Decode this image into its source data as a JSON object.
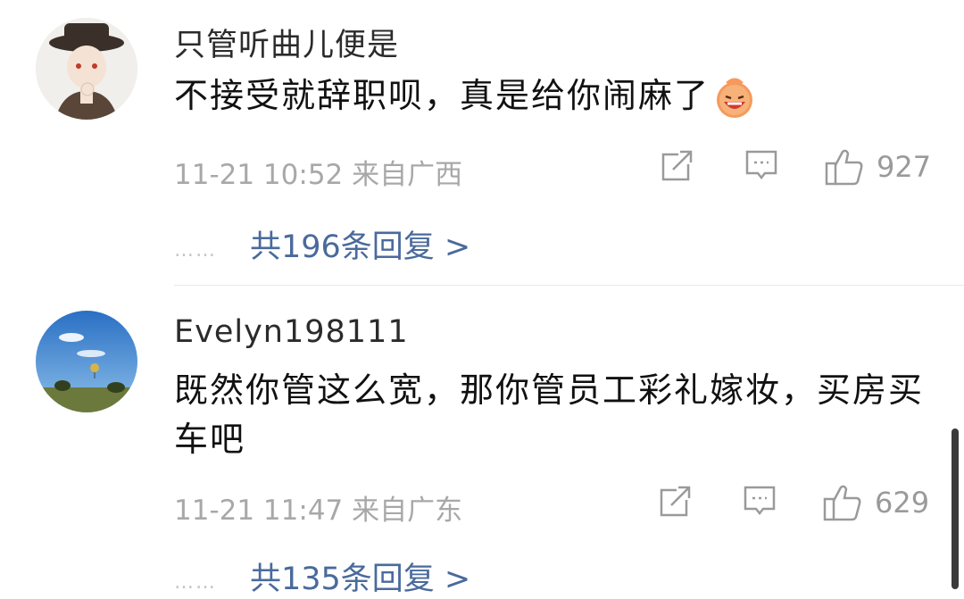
{
  "comments": [
    {
      "username": "只管听曲儿便是",
      "text": "不接受就辞职呗，真是给你闹麻了",
      "emoji": "laughing-emoji",
      "timestamp": "11-21 10:52",
      "location": "来自广西",
      "likes": "927",
      "dots": "……",
      "replies_label": "共196条回复 >"
    },
    {
      "username": "Evelyn198111",
      "text": "既然你管这么宽，那你管员工彩礼嫁妆，买房买车吧",
      "timestamp": "11-21 11:47",
      "location": "来自广东",
      "likes": "629",
      "dots": "……",
      "replies_label": "共135条回复 >"
    }
  ],
  "icons": {
    "share": "share-icon",
    "comment": "comment-icon",
    "like": "like-icon"
  },
  "colors": {
    "link": "#4a6a9c",
    "meta": "#a8a8a8",
    "text": "#111111"
  }
}
